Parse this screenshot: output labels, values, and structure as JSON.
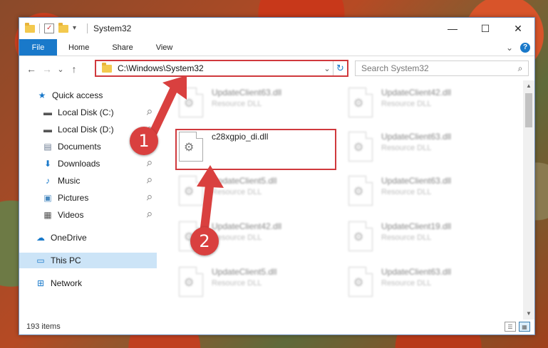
{
  "window": {
    "title": "System32",
    "controls": {
      "minimize": "—",
      "maximize": "☐",
      "close": "✕"
    }
  },
  "ribbon": {
    "tabs": [
      "File",
      "Home",
      "Share",
      "View"
    ],
    "expand": "⌄",
    "help": "?"
  },
  "nav": {
    "back": "←",
    "forward": "→",
    "recent": "⌄",
    "up": "↑",
    "address": "C:\\Windows\\System32",
    "address_dropdown": "⌄",
    "refresh": "↻",
    "search_placeholder": "Search System32",
    "search_icon": "⌕"
  },
  "sidebar": {
    "items": [
      {
        "label": "Quick access",
        "icon": "★",
        "icon_color": "#1979ca",
        "pinned": false
      },
      {
        "label": "Local Disk (C:)",
        "icon": "▬",
        "icon_color": "#555555",
        "pinned": true
      },
      {
        "label": "Local Disk (D:)",
        "icon": "▬",
        "icon_color": "#555555",
        "pinned": true
      },
      {
        "label": "Documents",
        "icon": "▤",
        "icon_color": "#6a7a90",
        "pinned": true
      },
      {
        "label": "Downloads",
        "icon": "⬇",
        "icon_color": "#1979ca",
        "pinned": true
      },
      {
        "label": "Music",
        "icon": "♪",
        "icon_color": "#1979ca",
        "pinned": true
      },
      {
        "label": "Pictures",
        "icon": "▣",
        "icon_color": "#4a8ac0",
        "pinned": true
      },
      {
        "label": "Videos",
        "icon": "▦",
        "icon_color": "#555555",
        "pinned": true
      },
      {
        "label": "OneDrive",
        "icon": "☁",
        "icon_color": "#1979ca",
        "pinned": false
      },
      {
        "label": "This PC",
        "icon": "▭",
        "icon_color": "#1979ca",
        "pinned": false
      },
      {
        "label": "Network",
        "icon": "⊞",
        "icon_color": "#1979ca",
        "pinned": false
      }
    ],
    "pin_icon": "📌"
  },
  "files": [
    {
      "name": "UpdateClient63.dll",
      "type": "Resource DLL",
      "blurred": true
    },
    {
      "name": "UpdateClient42.dll",
      "type": "Resource DLL",
      "blurred": true
    },
    {
      "name": "c28xgpio_di.dll",
      "type": "",
      "blurred": false
    },
    {
      "name": "UpdateClient63.dll",
      "type": "Resource DLL",
      "blurred": true
    },
    {
      "name": "UpdateClient5.dll",
      "type": "Resource DLL",
      "blurred": true
    },
    {
      "name": "UpdateClient63.dll",
      "type": "Resource DLL",
      "blurred": true
    },
    {
      "name": "UpdateClient42.dll",
      "type": "Resource DLL",
      "blurred": true
    },
    {
      "name": "UpdateClient19.dll",
      "type": "Resource DLL",
      "blurred": true
    },
    {
      "name": "UpdateClient5.dll",
      "type": "Resource DLL",
      "blurred": true
    },
    {
      "name": "UpdateClient63.dll",
      "type": "Resource DLL",
      "blurred": true
    }
  ],
  "gear_glyph": "⚙",
  "status": {
    "item_count": "193 items"
  },
  "annotations": {
    "badge1": "1",
    "badge2": "2",
    "color": "#d9403f"
  }
}
